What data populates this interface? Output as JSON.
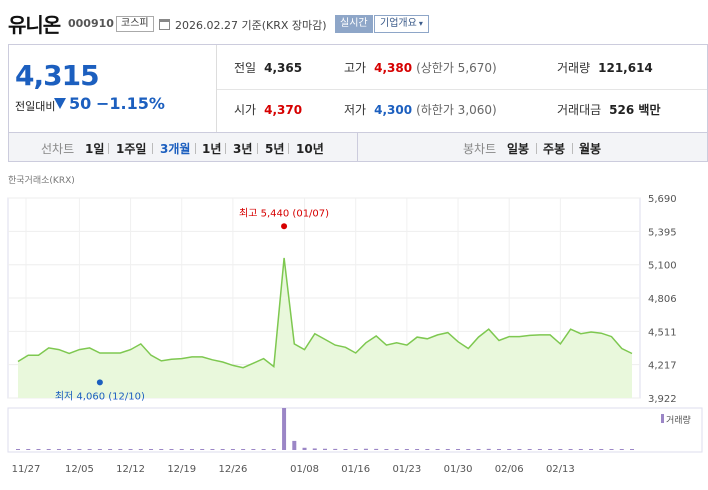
{
  "header": {
    "name": "유니온",
    "code": "000910",
    "market": "코스피",
    "date_text": "2026.02.27  기준(KRX 장마감)",
    "realtime_label": "실시간",
    "company_label": "기업개요"
  },
  "quote": {
    "price": "4,315",
    "change_label": "전일대비",
    "change_value": "50",
    "change_pct": "−1.15%",
    "prev_close_label": "전일",
    "prev_close": "4,365",
    "high_label": "고가",
    "high": "4,380",
    "upper_limit": "(상한가 5,670)",
    "volume_label": "거래량",
    "volume": "121,614",
    "open_label": "시가",
    "open": "4,370",
    "low_label": "저가",
    "low": "4,300",
    "lower_limit": "(하한가 3,060)",
    "value_label": "거래대금",
    "value": "526 백만"
  },
  "tabs": {
    "line_chart_label": "선차트",
    "periods": [
      "1일",
      "1주일",
      "3개월",
      "1년",
      "3년",
      "5년",
      "10년"
    ],
    "active_period": "3개월",
    "candle_chart_label": "봉차트",
    "candles": [
      "일봉",
      "주봉",
      "월봉"
    ]
  },
  "chart_source": "한국거래소(KRX)",
  "colors": {
    "up": "#d60000",
    "down": "#1c5fbf",
    "line": "#7ec850",
    "fill": "#e9f8dc",
    "volume": "#9b86c6"
  },
  "chart_data": {
    "type": "area",
    "ylim": [
      3922,
      5690
    ],
    "yticks": [
      "5,690",
      "5,395",
      "5,100",
      "4,806",
      "4,511",
      "4,217",
      "3,922"
    ],
    "yticks_values": [
      5690,
      5395,
      5100,
      4806,
      4511,
      4217,
      3922
    ],
    "x_labels": [
      "11/27",
      "12/05",
      "12/12",
      "12/19",
      "12/26",
      "01/08",
      "01/16",
      "01/23",
      "01/30",
      "02/06",
      "02/13"
    ],
    "values": [
      4245,
      4300,
      4300,
      4365,
      4350,
      4315,
      4350,
      4365,
      4320,
      4320,
      4320,
      4350,
      4400,
      4300,
      4250,
      4265,
      4270,
      4285,
      4285,
      4260,
      4240,
      4210,
      4190,
      4230,
      4270,
      4200,
      5160,
      4400,
      4350,
      4490,
      4440,
      4390,
      4370,
      4320,
      4410,
      4470,
      4390,
      4410,
      4390,
      4460,
      4445,
      4480,
      4500,
      4420,
      4360,
      4460,
      4530,
      4430,
      4465,
      4465,
      4475,
      4480,
      4480,
      4400,
      4530,
      4490,
      4505,
      4495,
      4465,
      4360,
      4315
    ],
    "volumes": [
      30,
      28,
      25,
      40,
      22,
      26,
      35,
      30,
      28,
      24,
      20,
      30,
      45,
      50,
      35,
      25,
      30,
      28,
      26,
      32,
      30,
      28,
      35,
      40,
      38,
      60,
      3000,
      650,
      160,
      110,
      90,
      80,
      70,
      60,
      90,
      80,
      60,
      50,
      45,
      60,
      70,
      55,
      50,
      45,
      40,
      60,
      80,
      55,
      50,
      45,
      40,
      50,
      45,
      40,
      70,
      55,
      60,
      50,
      45,
      60,
      40
    ],
    "annotations": [
      {
        "text": "최고 5,440 (01/07)",
        "value": 5440,
        "kind": "max"
      },
      {
        "text": "최저 4,060 (12/10)",
        "value": 4060,
        "kind": "min"
      }
    ],
    "volume_legend": "거래량"
  }
}
